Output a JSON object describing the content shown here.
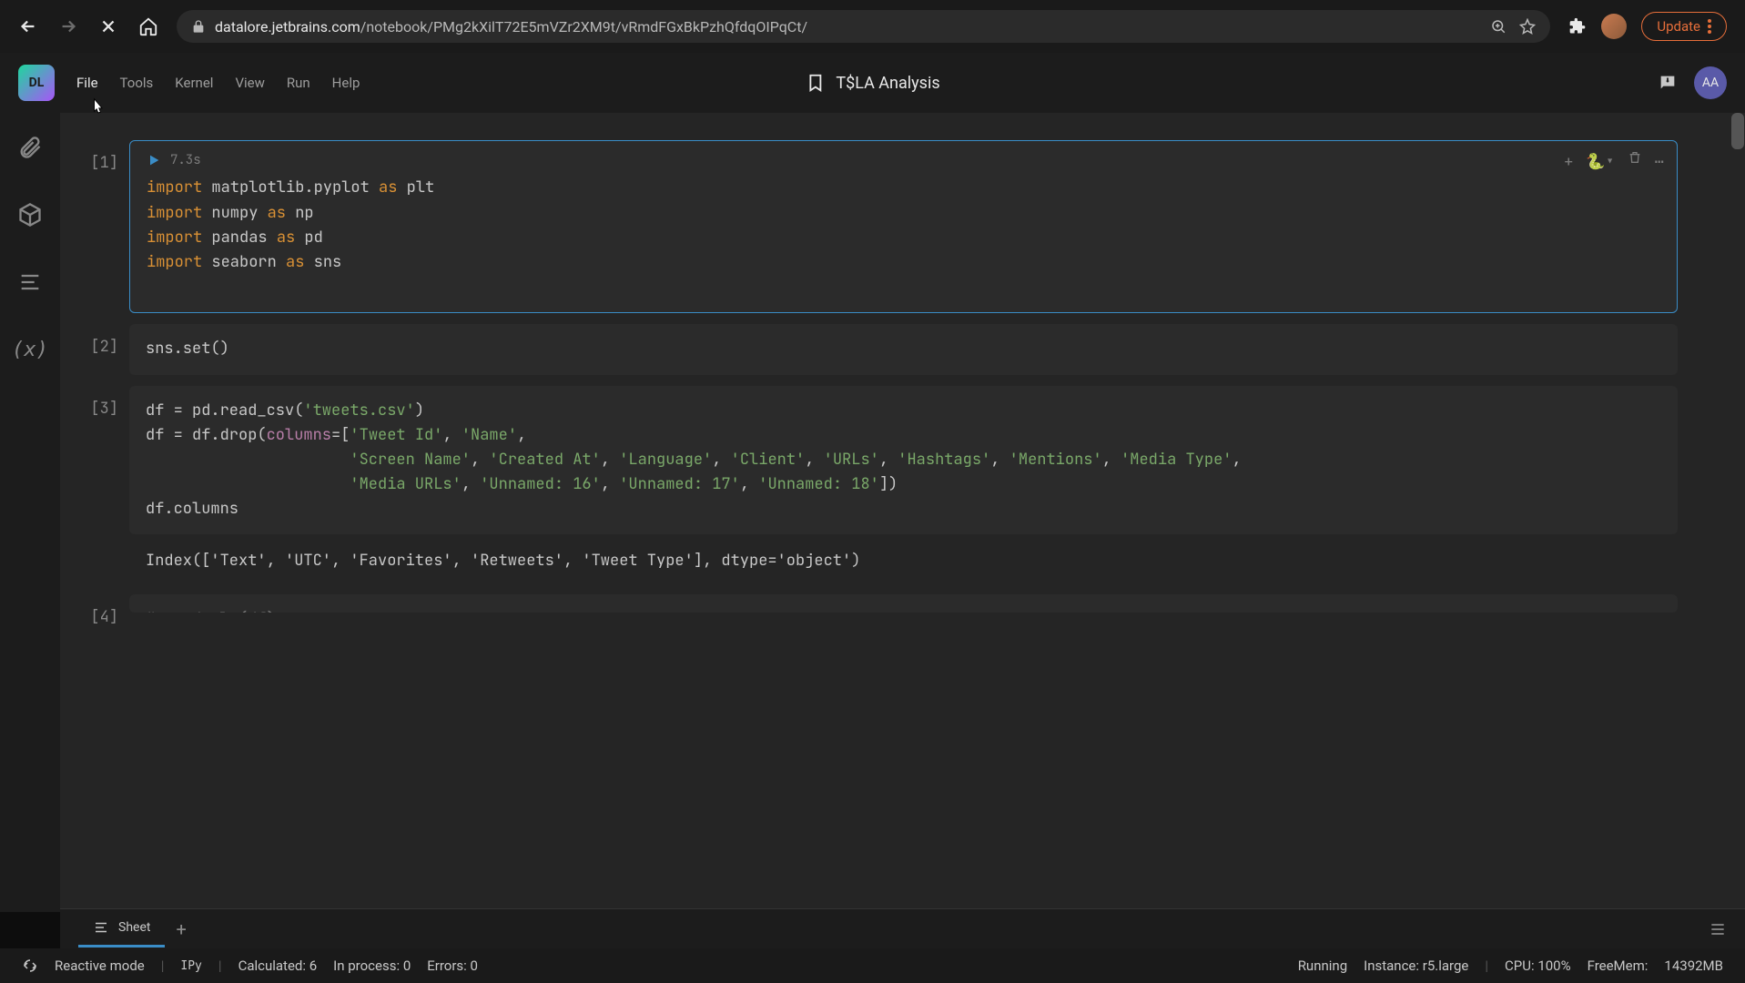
{
  "browser": {
    "url_host": "datalore.jetbrains.com",
    "url_path": "/notebook/PMg2kXilT72E5mVZr2XM9t/vRmdFGxBkPzhQfdqOIPqCt/",
    "update_label": "Update"
  },
  "app": {
    "logo_text": "DL",
    "menu": [
      "File",
      "Tools",
      "Kernel",
      "View",
      "Run",
      "Help"
    ],
    "title": "T$LA Analysis",
    "avatar": "AA"
  },
  "cells": [
    {
      "num": "[1]",
      "exec_time": "7.3s",
      "active": true,
      "code_html": "<span class='kw'>import</span> matplotlib.pyplot <span class='kw'>as</span> plt\n<span class='kw'>import</span> numpy <span class='kw'>as</span> np\n<span class='kw'>import</span> pandas <span class='kw'>as</span> pd\n<span class='kw'>import</span> seaborn <span class='kw'>as</span> sns\n"
    },
    {
      "num": "[2]",
      "code_html": "sns.set()"
    },
    {
      "num": "[3]",
      "code_html": "df = pd.read_csv(<span class='str'>'tweets.csv'</span>)\ndf = df.drop(<span class='param'>columns</span>=[<span class='str'>'Tweet Id'</span>, <span class='str'>'Name'</span>,\n                      <span class='str'>'Screen Name'</span>, <span class='str'>'Created At'</span>, <span class='str'>'Language'</span>, <span class='str'>'Client'</span>, <span class='str'>'URLs'</span>, <span class='str'>'Hashtags'</span>, <span class='str'>'Mentions'</span>, <span class='str'>'Media Type'</span>,\n                      <span class='str'>'Media URLs'</span>, <span class='str'>'Unnamed: 16'</span>, <span class='str'>'Unnamed: 17'</span>, <span class='str'>'Unnamed: 18'</span>])\ndf.columns",
      "output": "Index(['Text', 'UTC', 'Favorites', 'Retweets', 'Tweet Type'], dtype='object')"
    },
    {
      "num": "[4]",
      "code_html": "# randomly(df)"
    }
  ],
  "sheet": {
    "tab_label": "Sheet"
  },
  "status": {
    "mode": "Reactive mode",
    "kernel": "IPy",
    "calculated": "Calculated: 6",
    "in_process": "In process: 0",
    "errors": "Errors: 0",
    "running": "Running",
    "instance": "Instance: r5.large",
    "cpu": "CPU: 100%",
    "freemem_label": "FreeMem:",
    "freemem_val": "14392MB"
  }
}
